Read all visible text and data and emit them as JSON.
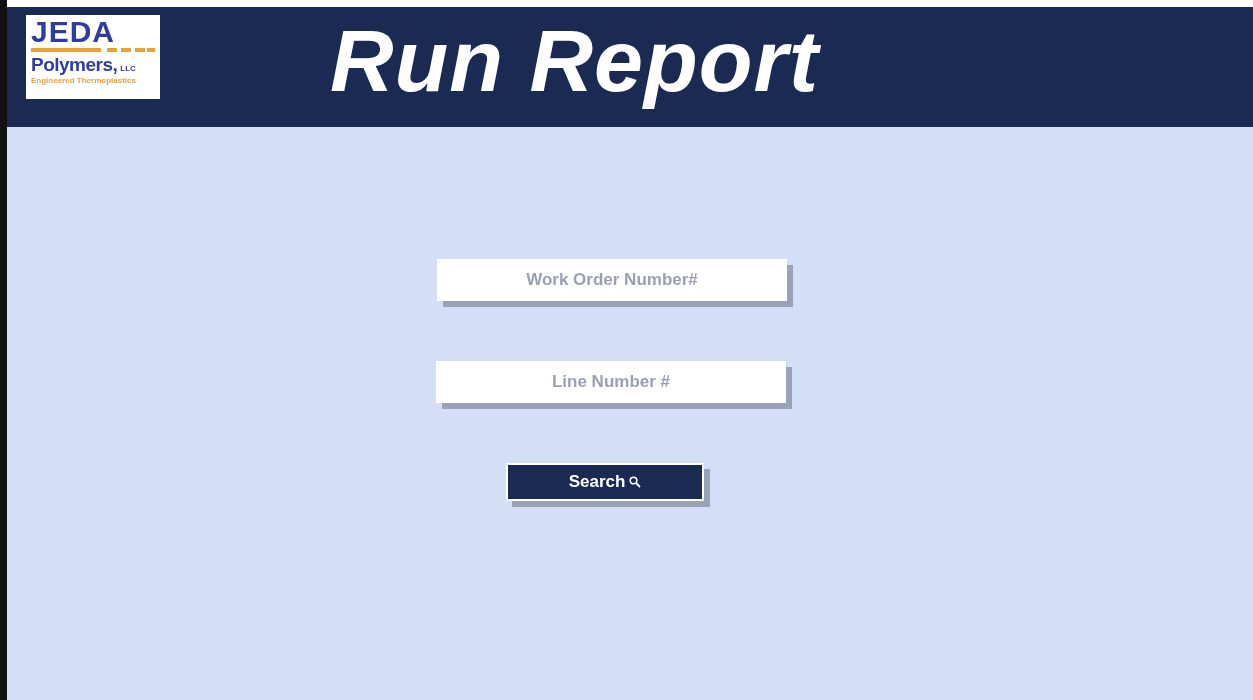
{
  "logo": {
    "name": "JEDA",
    "company": "Polymers,",
    "suffix": "LLC",
    "tagline": "Engineered Thermoplastics"
  },
  "title": "Run Report",
  "fields": [
    {
      "placeholder": "Work Order Number#"
    },
    {
      "placeholder": "Line Number #"
    }
  ],
  "search_button": {
    "label": "Search"
  }
}
